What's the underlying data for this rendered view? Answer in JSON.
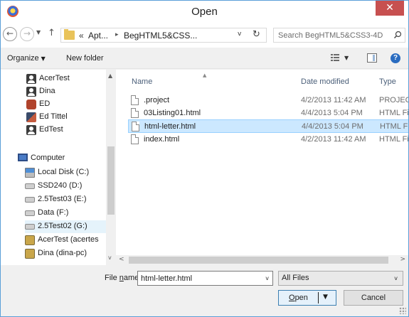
{
  "window": {
    "title": "Open",
    "close_symbol": "✕",
    "app_icon": "browser-icon"
  },
  "address": {
    "overflow": "«",
    "crumbs": [
      "Apt...",
      "BegHTML5&CSS..."
    ],
    "separator": "▸",
    "dropdown_symbol": "v",
    "refresh_symbol": "↻",
    "search_placeholder": "Search BegHTML5&CSS3-4D"
  },
  "nav_buttons": {
    "back": "←",
    "forward": "→",
    "recent": "▼",
    "up": "↑"
  },
  "toolbar": {
    "organize": "Organize",
    "new_folder": "New folder",
    "dropdown_arrow": "▼",
    "help": "?"
  },
  "navigation": {
    "users": [
      {
        "label": "AcerTest",
        "icon": "user-icon"
      },
      {
        "label": "Dina",
        "icon": "user-icon"
      },
      {
        "label": "ED",
        "icon": "user-photo-icon"
      },
      {
        "label": "Ed Tittel",
        "icon": "user-photo-icon"
      },
      {
        "label": "EdTest",
        "icon": "user-icon"
      }
    ],
    "computer": {
      "label": "Computer",
      "icon": "computer-icon"
    },
    "drives": [
      {
        "label": "Local Disk (C:)",
        "icon": "windows-drive-icon"
      },
      {
        "label": "SSD240 (D:)",
        "icon": "drive-icon"
      },
      {
        "label": "2.5Test03 (E:)",
        "icon": "drive-icon"
      },
      {
        "label": "Data (F:)",
        "icon": "drive-icon"
      },
      {
        "label": "2.5Test02 (G:)",
        "icon": "drive-icon"
      },
      {
        "label": "AcerTest (acertes",
        "icon": "network-drive-icon"
      },
      {
        "label": "Dina (dina-pc)",
        "icon": "network-drive-icon"
      }
    ]
  },
  "files": {
    "columns": {
      "name": "Name",
      "date": "Date modified",
      "type": "Type",
      "sort_symbol": "▲"
    },
    "rows": [
      {
        "name": ".project",
        "date": "4/2/2013 11:42 AM",
        "type": "PROJECT",
        "selected": false
      },
      {
        "name": "03Listing01.html",
        "date": "4/4/2013 5:04 PM",
        "type": "HTML Fil",
        "selected": false
      },
      {
        "name": "html-letter.html",
        "date": "4/4/2013 5:04 PM",
        "type": "HTML Fil",
        "selected": true
      },
      {
        "name": "index.html",
        "date": "4/2/2013 11:42 AM",
        "type": "HTML Fil",
        "selected": false
      }
    ]
  },
  "scroll": {
    "up": "▲",
    "down": "v",
    "left": "<",
    "right": ">"
  },
  "footer": {
    "filename_label_prefix": "File ",
    "filename_label_underlined": "n",
    "filename_label_suffix": "ame:",
    "filename_value": "html-letter.html",
    "filter_value": "All Files",
    "dropdown_arrow": "v",
    "open_underlined": "O",
    "open_rest": "pen",
    "open_drop": "▼",
    "cancel": "Cancel"
  },
  "colors": {
    "accent": "#3c7fb1",
    "selection": "#cce8ff",
    "close": "#c75050",
    "window_border": "#5a9fd8"
  }
}
